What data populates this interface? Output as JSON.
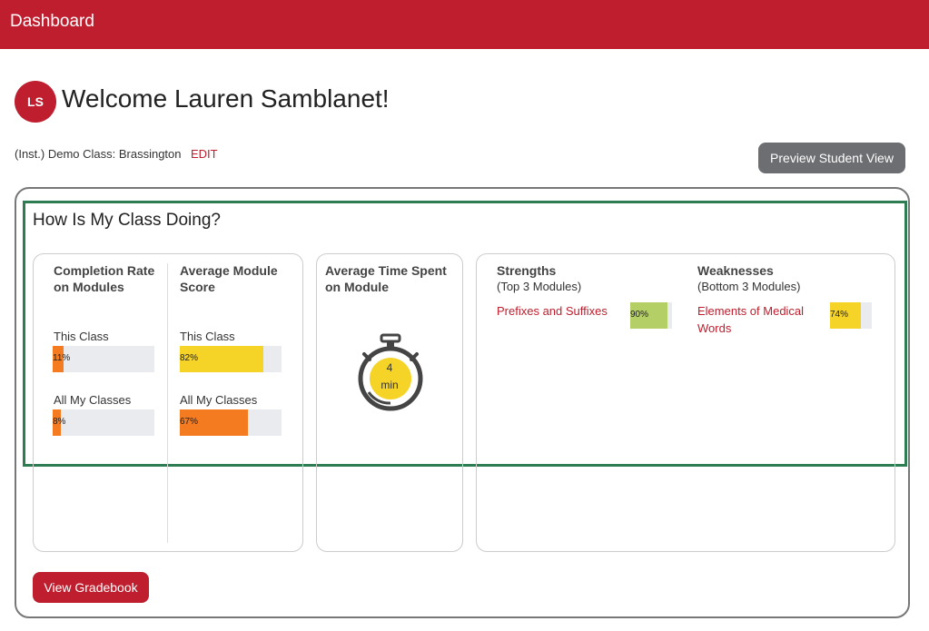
{
  "header": {
    "title": "Dashboard"
  },
  "user": {
    "initials": "LS",
    "welcome": "Welcome Lauren Samblanet!"
  },
  "class_info": {
    "name": "(Inst.) Demo Class: Brassington",
    "edit_label": "EDIT"
  },
  "preview_button": {
    "label": "Preview Student View"
  },
  "section": {
    "title": "How Is My Class Doing?"
  },
  "completion": {
    "heading_line1": "Completion Rate",
    "heading_line2": "on Modules",
    "this_class_label": "This Class",
    "this_class_value": "11%",
    "this_class_fraction": 0.11,
    "all_classes_label": "All My Classes",
    "all_classes_value": "8%",
    "all_classes_fraction": 0.08
  },
  "score": {
    "heading_line1": "Average Module",
    "heading_line2": "Score",
    "this_class_label": "This Class",
    "this_class_value": "82%",
    "this_class_fraction": 0.82,
    "all_classes_label": "All My Classes",
    "all_classes_value": "67%",
    "all_classes_fraction": 0.67
  },
  "time": {
    "heading_line1": "Average Time Spent",
    "heading_line2": "on Module",
    "value": "4",
    "unit": "min"
  },
  "strengths": {
    "heading": "Strengths",
    "sub": "(Top 3 Modules)",
    "items": [
      {
        "line1": "Prefixes and Suffixes",
        "line2": "",
        "value": "90%",
        "fraction": 0.9
      }
    ]
  },
  "weaknesses": {
    "heading": "Weaknesses",
    "sub": "(Bottom 3 Modules)",
    "items": [
      {
        "line1": "Elements of Medical",
        "line2": "Words",
        "value": "74%",
        "fraction": 0.74
      }
    ]
  },
  "gradebook_button": {
    "label": "View Gradebook"
  },
  "colors": {
    "brand_red": "#be1e2d",
    "low_orange": "#f47b20",
    "mid_yellow": "#f5d327",
    "good_green": "#b5cf67",
    "track_gray": "#e9ebee",
    "highlight_green": "#2e7d52"
  }
}
